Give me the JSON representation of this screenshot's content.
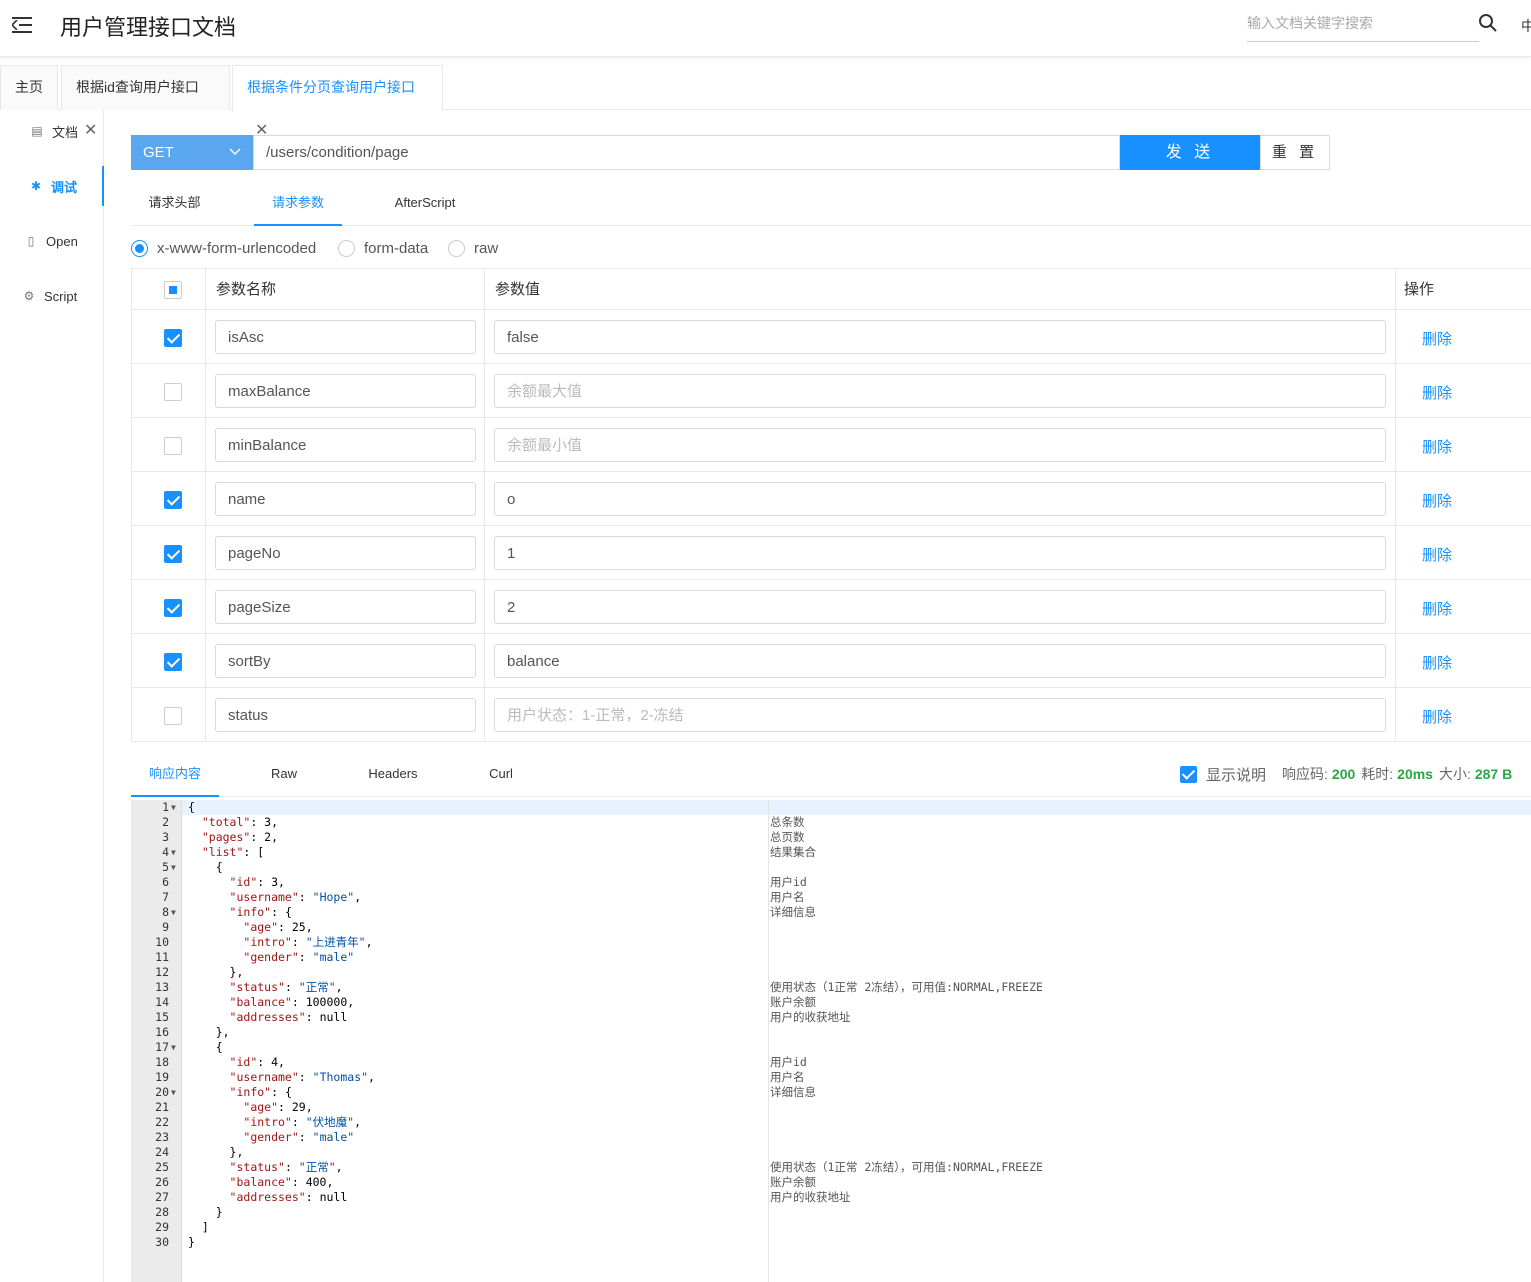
{
  "header": {
    "title": "用户管理接口文档",
    "search_placeholder": "输入文档关键字搜索",
    "lang_label": "中"
  },
  "tabs": [
    {
      "label": "主页",
      "closable": false,
      "active": false
    },
    {
      "label": "根据id查询用户接口",
      "closable": true,
      "active": false
    },
    {
      "label": "根据条件分页查询用户接口",
      "closable": true,
      "active": true
    }
  ],
  "leftnav": [
    {
      "label": "文档",
      "icon": "document-icon",
      "active": false
    },
    {
      "label": "调试",
      "icon": "bug-icon",
      "active": true
    },
    {
      "label": "Open",
      "icon": "file-icon",
      "active": false
    },
    {
      "label": "Script",
      "icon": "code-icon",
      "active": false
    }
  ],
  "request": {
    "method": "GET",
    "url": "/users/condition/page",
    "send_label": "发 送",
    "reset_label": "重 置"
  },
  "subtabs": [
    "请求头部",
    "请求参数",
    "AfterScript"
  ],
  "body_types": [
    {
      "label": "x-www-form-urlencoded",
      "checked": true
    },
    {
      "label": "form-data",
      "checked": false
    },
    {
      "label": "raw",
      "checked": false
    }
  ],
  "params_table": {
    "headers": {
      "name": "参数名称",
      "value": "参数值",
      "action": "操作"
    },
    "rows": [
      {
        "checked": true,
        "name": "isAsc",
        "value": "false",
        "placeholder": "",
        "action": "删除"
      },
      {
        "checked": false,
        "name": "maxBalance",
        "value": "",
        "placeholder": "余额最大值",
        "action": "删除"
      },
      {
        "checked": false,
        "name": "minBalance",
        "value": "",
        "placeholder": "余额最小值",
        "action": "删除"
      },
      {
        "checked": true,
        "name": "name",
        "value": "o",
        "placeholder": "",
        "action": "删除"
      },
      {
        "checked": true,
        "name": "pageNo",
        "value": "1",
        "placeholder": "",
        "action": "删除"
      },
      {
        "checked": true,
        "name": "pageSize",
        "value": "2",
        "placeholder": "",
        "action": "删除"
      },
      {
        "checked": true,
        "name": "sortBy",
        "value": "balance",
        "placeholder": "",
        "action": "删除"
      },
      {
        "checked": false,
        "name": "status",
        "value": "",
        "placeholder": "用户状态：1-正常，2-冻结",
        "action": "删除"
      }
    ]
  },
  "response": {
    "tabs": [
      "响应内容",
      "Raw",
      "Headers",
      "Curl"
    ],
    "show_desc_label": "显示说明",
    "code_label": "响应码:",
    "code_value": "200",
    "time_label": "耗时:",
    "time_value": "20ms",
    "size_label": "大小:",
    "size_value": "287 B",
    "lines": [
      {
        "n": "1",
        "fold": true,
        "code": "{",
        "desc": ""
      },
      {
        "n": "2",
        "fold": false,
        "code": "  \"total\": 3,",
        "desc": "总条数"
      },
      {
        "n": "3",
        "fold": false,
        "code": "  \"pages\": 2,",
        "desc": "总页数"
      },
      {
        "n": "4",
        "fold": true,
        "code": "  \"list\": [",
        "desc": "结果集合"
      },
      {
        "n": "5",
        "fold": true,
        "code": "    {",
        "desc": ""
      },
      {
        "n": "6",
        "fold": false,
        "code": "      \"id\": 3,",
        "desc": "用户id"
      },
      {
        "n": "7",
        "fold": false,
        "code": "      \"username\": \"Hope\",",
        "desc": "用户名"
      },
      {
        "n": "8",
        "fold": true,
        "code": "      \"info\": {",
        "desc": "详细信息"
      },
      {
        "n": "9",
        "fold": false,
        "code": "        \"age\": 25,",
        "desc": ""
      },
      {
        "n": "10",
        "fold": false,
        "code": "        \"intro\": \"上进青年\",",
        "desc": ""
      },
      {
        "n": "11",
        "fold": false,
        "code": "        \"gender\": \"male\"",
        "desc": ""
      },
      {
        "n": "12",
        "fold": false,
        "code": "      },",
        "desc": ""
      },
      {
        "n": "13",
        "fold": false,
        "code": "      \"status\": \"正常\",",
        "desc": "使用状态（1正常 2冻结），可用值:NORMAL,FREEZE"
      },
      {
        "n": "14",
        "fold": false,
        "code": "      \"balance\": 100000,",
        "desc": "账户余额"
      },
      {
        "n": "15",
        "fold": false,
        "code": "      \"addresses\": null",
        "desc": "用户的收获地址"
      },
      {
        "n": "16",
        "fold": false,
        "code": "    },",
        "desc": ""
      },
      {
        "n": "17",
        "fold": true,
        "code": "    {",
        "desc": ""
      },
      {
        "n": "18",
        "fold": false,
        "code": "      \"id\": 4,",
        "desc": "用户id"
      },
      {
        "n": "19",
        "fold": false,
        "code": "      \"username\": \"Thomas\",",
        "desc": "用户名"
      },
      {
        "n": "20",
        "fold": true,
        "code": "      \"info\": {",
        "desc": "详细信息"
      },
      {
        "n": "21",
        "fold": false,
        "code": "        \"age\": 29,",
        "desc": ""
      },
      {
        "n": "22",
        "fold": false,
        "code": "        \"intro\": \"伏地魔\",",
        "desc": ""
      },
      {
        "n": "23",
        "fold": false,
        "code": "        \"gender\": \"male\"",
        "desc": ""
      },
      {
        "n": "24",
        "fold": false,
        "code": "      },",
        "desc": ""
      },
      {
        "n": "25",
        "fold": false,
        "code": "      \"status\": \"正常\",",
        "desc": "使用状态（1正常 2冻结），可用值:NORMAL,FREEZE"
      },
      {
        "n": "26",
        "fold": false,
        "code": "      \"balance\": 400,",
        "desc": "账户余额"
      },
      {
        "n": "27",
        "fold": false,
        "code": "      \"addresses\": null",
        "desc": "用户的收获地址"
      },
      {
        "n": "28",
        "fold": false,
        "code": "    }",
        "desc": ""
      },
      {
        "n": "29",
        "fold": false,
        "code": "  ]",
        "desc": ""
      },
      {
        "n": "30",
        "fold": false,
        "code": "}",
        "desc": ""
      }
    ]
  },
  "colors": {
    "accent": "#1890ff",
    "method_bg": "#5aa7f0",
    "status_ok": "#28a745"
  }
}
